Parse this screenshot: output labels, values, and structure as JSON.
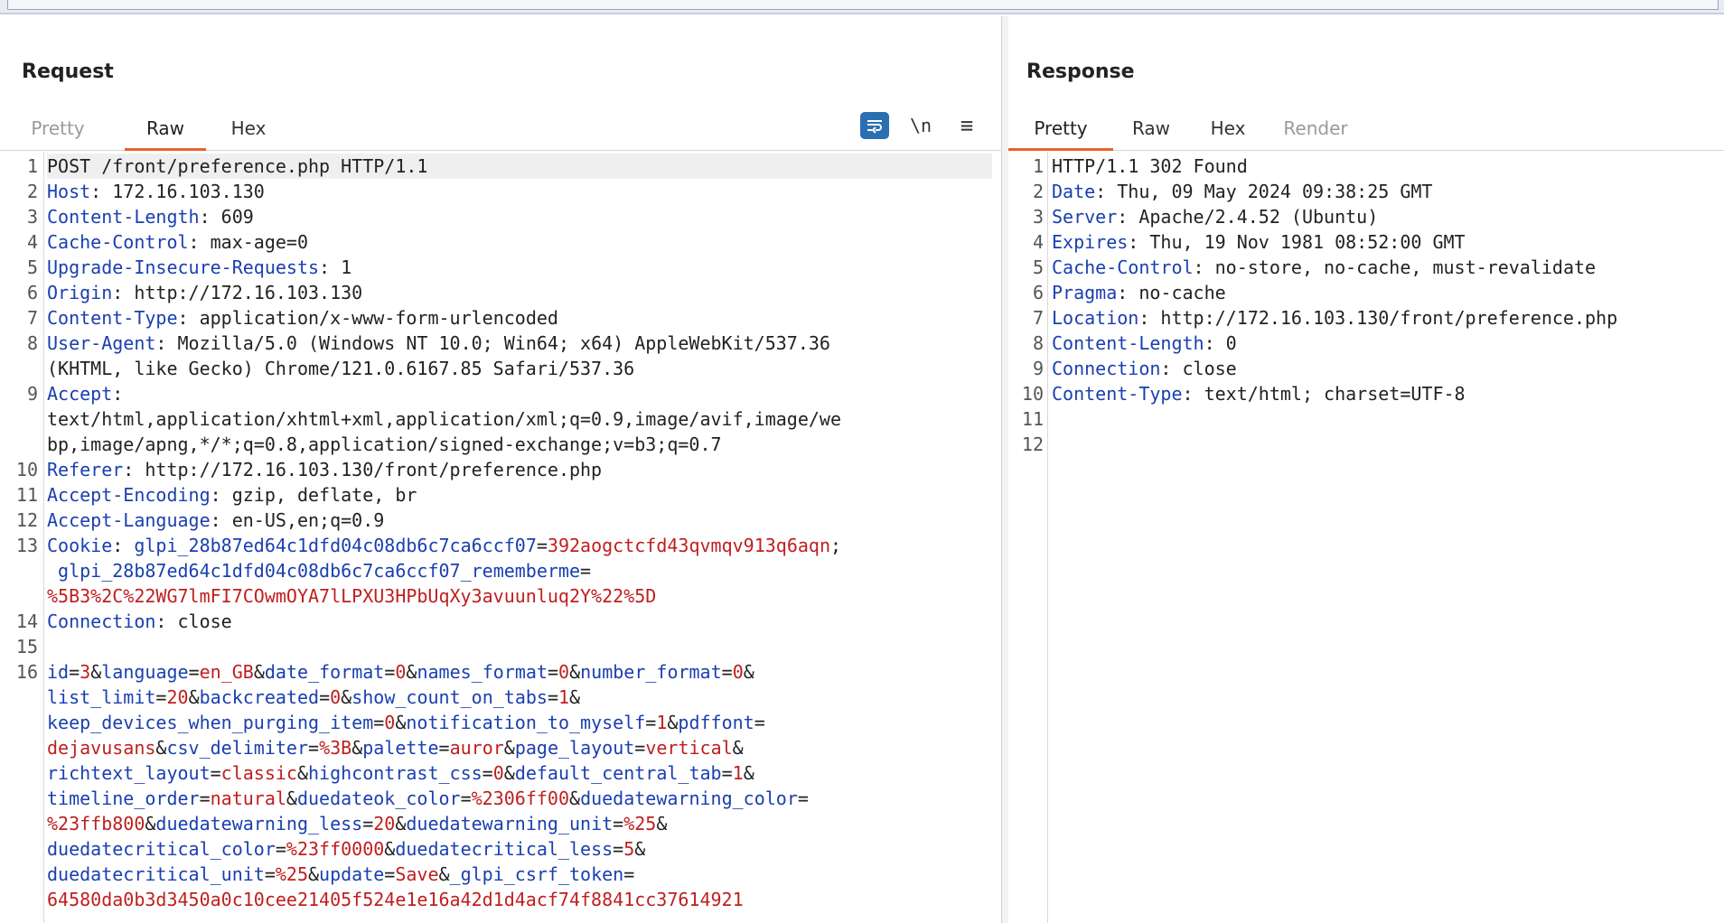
{
  "request": {
    "title": "Request",
    "tabs": [
      {
        "label": "Pretty"
      },
      {
        "label": "Raw"
      },
      {
        "label": "Hex"
      }
    ],
    "tools": {
      "newline": "\\n",
      "menu": "≡"
    },
    "line_numbers": [
      "1",
      "2",
      "3",
      "4",
      "5",
      "6",
      "7",
      "8",
      "9",
      "10",
      "11",
      "12",
      "13",
      "14",
      "15",
      "16"
    ],
    "lines": [
      [
        {
          "t": "POST /front/preference.php HTTP/1.1"
        }
      ],
      [
        {
          "k": "Host"
        },
        {
          "t": ": 172.16.103.130"
        }
      ],
      [
        {
          "k": "Content-Length"
        },
        {
          "t": ": 609"
        }
      ],
      [
        {
          "k": "Cache-Control"
        },
        {
          "t": ": max-age=0"
        }
      ],
      [
        {
          "k": "Upgrade-Insecure-Requests"
        },
        {
          "t": ": 1"
        }
      ],
      [
        {
          "k": "Origin"
        },
        {
          "t": ": http://172.16.103.130"
        }
      ],
      [
        {
          "k": "Content-Type"
        },
        {
          "t": ": application/x-www-form-urlencoded"
        }
      ],
      [
        {
          "k": "User-Agent"
        },
        {
          "t": ": Mozilla/5.0 (Windows NT 10.0; Win64; x64) AppleWebKit/537.36"
        }
      ],
      [
        {
          "t": "(KHTML, like Gecko) Chrome/121.0.6167.85 Safari/537.36"
        }
      ],
      [
        {
          "k": "Accept"
        },
        {
          "t": ":"
        }
      ],
      [
        {
          "t": "text/html,application/xhtml+xml,application/xml;q=0.9,image/avif,image/we"
        }
      ],
      [
        {
          "t": "bp,image/apng,*/*;q=0.8,application/signed-exchange;v=b3;q=0.7"
        }
      ],
      [
        {
          "k": "Referer"
        },
        {
          "t": ": http://172.16.103.130/front/preference.php"
        }
      ],
      [
        {
          "k": "Accept-Encoding"
        },
        {
          "t": ": gzip, deflate, br"
        }
      ],
      [
        {
          "k": "Accept-Language"
        },
        {
          "t": ": en-US,en;q=0.9"
        }
      ],
      [
        {
          "k": "Cookie"
        },
        {
          "t": ": "
        },
        {
          "k": "glpi_28b87ed64c1dfd04c08db6c7ca6ccf07"
        },
        {
          "t": "="
        },
        {
          "v": "392aogctcfd43qvmqv913q6aqn"
        },
        {
          "t": ";"
        }
      ],
      [
        {
          "t": " "
        },
        {
          "k": "glpi_28b87ed64c1dfd04c08db6c7ca6ccf07_rememberme"
        },
        {
          "t": "="
        }
      ],
      [
        {
          "v": "%5B3%2C%22WG7lmFI7COwmOYA7lLPXU3HPbUqXy3avuunluq2Y%22%5D"
        }
      ],
      [
        {
          "k": "Connection"
        },
        {
          "t": ": close"
        }
      ],
      [],
      [
        {
          "k": "id"
        },
        {
          "t": "="
        },
        {
          "v": "3"
        },
        {
          "t": "&"
        },
        {
          "k": "language"
        },
        {
          "t": "="
        },
        {
          "v": "en_GB"
        },
        {
          "t": "&"
        },
        {
          "k": "date_format"
        },
        {
          "t": "="
        },
        {
          "v": "0"
        },
        {
          "t": "&"
        },
        {
          "k": "names_format"
        },
        {
          "t": "="
        },
        {
          "v": "0"
        },
        {
          "t": "&"
        },
        {
          "k": "number_format"
        },
        {
          "t": "="
        },
        {
          "v": "0"
        },
        {
          "t": "&"
        }
      ],
      [
        {
          "k": "list_limit"
        },
        {
          "t": "="
        },
        {
          "v": "20"
        },
        {
          "t": "&"
        },
        {
          "k": "backcreated"
        },
        {
          "t": "="
        },
        {
          "v": "0"
        },
        {
          "t": "&"
        },
        {
          "k": "show_count_on_tabs"
        },
        {
          "t": "="
        },
        {
          "v": "1"
        },
        {
          "t": "&"
        }
      ],
      [
        {
          "k": "keep_devices_when_purging_item"
        },
        {
          "t": "="
        },
        {
          "v": "0"
        },
        {
          "t": "&"
        },
        {
          "k": "notification_to_myself"
        },
        {
          "t": "="
        },
        {
          "v": "1"
        },
        {
          "t": "&"
        },
        {
          "k": "pdffont"
        },
        {
          "t": "="
        }
      ],
      [
        {
          "v": "dejavusans"
        },
        {
          "t": "&"
        },
        {
          "k": "csv_delimiter"
        },
        {
          "t": "="
        },
        {
          "v": "%3B"
        },
        {
          "t": "&"
        },
        {
          "k": "palette"
        },
        {
          "t": "="
        },
        {
          "v": "auror"
        },
        {
          "t": "&"
        },
        {
          "k": "page_layout"
        },
        {
          "t": "="
        },
        {
          "v": "vertical"
        },
        {
          "t": "&"
        }
      ],
      [
        {
          "k": "richtext_layout"
        },
        {
          "t": "="
        },
        {
          "v": "classic"
        },
        {
          "t": "&"
        },
        {
          "k": "highcontrast_css"
        },
        {
          "t": "="
        },
        {
          "v": "0"
        },
        {
          "t": "&"
        },
        {
          "k": "default_central_tab"
        },
        {
          "t": "="
        },
        {
          "v": "1"
        },
        {
          "t": "&"
        }
      ],
      [
        {
          "k": "timeline_order"
        },
        {
          "t": "="
        },
        {
          "v": "natural"
        },
        {
          "t": "&"
        },
        {
          "k": "duedateok_color"
        },
        {
          "t": "="
        },
        {
          "v": "%2306ff00"
        },
        {
          "t": "&"
        },
        {
          "k": "duedatewarning_color"
        },
        {
          "t": "="
        }
      ],
      [
        {
          "v": "%23ffb800"
        },
        {
          "t": "&"
        },
        {
          "k": "duedatewarning_less"
        },
        {
          "t": "="
        },
        {
          "v": "20"
        },
        {
          "t": "&"
        },
        {
          "k": "duedatewarning_unit"
        },
        {
          "t": "="
        },
        {
          "v": "%25"
        },
        {
          "t": "&"
        }
      ],
      [
        {
          "k": "duedatecritical_color"
        },
        {
          "t": "="
        },
        {
          "v": "%23ff0000"
        },
        {
          "t": "&"
        },
        {
          "k": "duedatecritical_less"
        },
        {
          "t": "="
        },
        {
          "v": "5"
        },
        {
          "t": "&"
        }
      ],
      [
        {
          "k": "duedatecritical_unit"
        },
        {
          "t": "="
        },
        {
          "v": "%25"
        },
        {
          "t": "&"
        },
        {
          "k": "update"
        },
        {
          "t": "="
        },
        {
          "v": "Save"
        },
        {
          "t": "&"
        },
        {
          "k": "_glpi_csrf_token"
        },
        {
          "t": "="
        }
      ],
      [
        {
          "v": "64580da0b3d3450a0c10cee21405f524e1e16a42d1d4acf74f8841cc37614921"
        }
      ]
    ]
  },
  "response": {
    "title": "Response",
    "tabs": [
      {
        "label": "Pretty"
      },
      {
        "label": "Raw"
      },
      {
        "label": "Hex"
      },
      {
        "label": "Render"
      }
    ],
    "line_numbers": [
      "1",
      "2",
      "3",
      "4",
      "5",
      "6",
      "7",
      "8",
      "9",
      "10",
      "11",
      "12"
    ],
    "lines": [
      [
        {
          "t": "HTTP/1.1 302 Found"
        }
      ],
      [
        {
          "k": "Date"
        },
        {
          "t": ": Thu, 09 May 2024 09:38:25 GMT"
        }
      ],
      [
        {
          "k": "Server"
        },
        {
          "t": ": Apache/2.4.52 (Ubuntu)"
        }
      ],
      [
        {
          "k": "Expires"
        },
        {
          "t": ": Thu, 19 Nov 1981 08:52:00 GMT"
        }
      ],
      [
        {
          "k": "Cache-Control"
        },
        {
          "t": ": no-store, no-cache, must-revalidate"
        }
      ],
      [
        {
          "k": "Pragma"
        },
        {
          "t": ": no-cache"
        }
      ],
      [
        {
          "k": "Location"
        },
        {
          "t": ": http://172.16.103.130/front/preference.php"
        }
      ],
      [
        {
          "k": "Content-Length"
        },
        {
          "t": ": 0"
        }
      ],
      [
        {
          "k": "Connection"
        },
        {
          "t": ": close"
        }
      ],
      [
        {
          "k": "Content-Type"
        },
        {
          "t": ": text/html; charset=UTF-8"
        }
      ],
      [],
      []
    ]
  }
}
